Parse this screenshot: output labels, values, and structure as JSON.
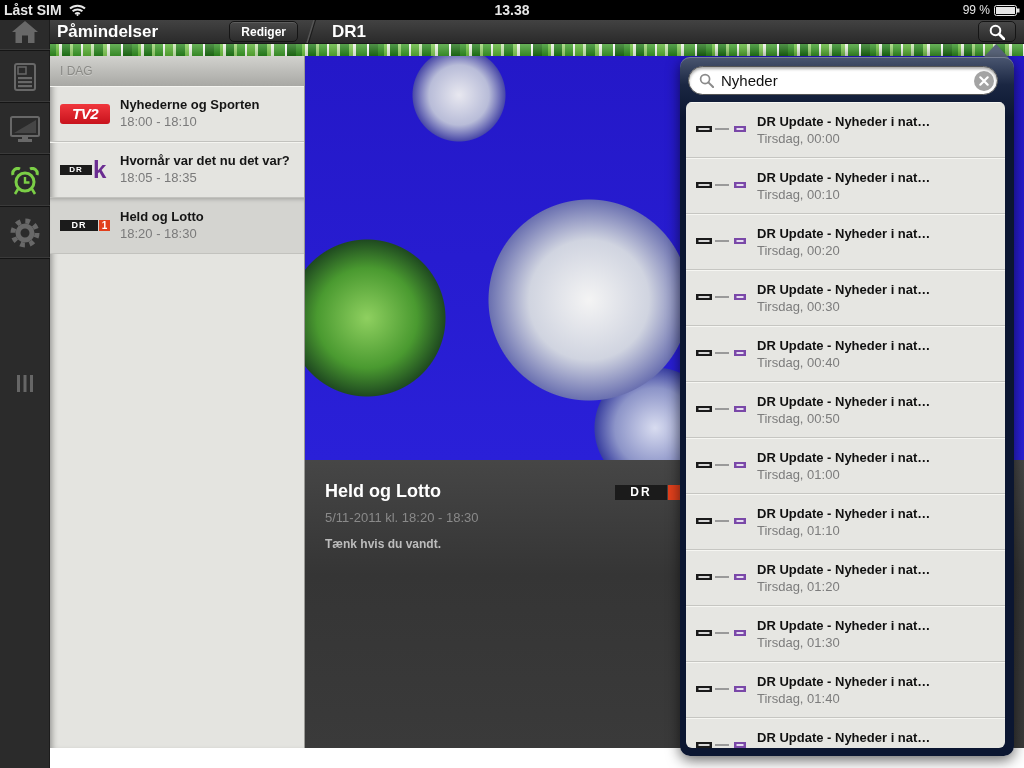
{
  "status_bar": {
    "carrier": "Låst SIM",
    "time": "13.38",
    "battery": "99 %"
  },
  "sidebar": {
    "items": [
      {
        "kind": "home",
        "selected": false
      },
      {
        "kind": "guide",
        "selected": false
      },
      {
        "kind": "tv",
        "selected": false
      },
      {
        "kind": "alarm",
        "selected": true
      },
      {
        "kind": "settings",
        "selected": false
      }
    ]
  },
  "nav_bar": {
    "title": "Påmindelser",
    "edit_button": "Rediger",
    "detail_title": "DR1"
  },
  "reminders": {
    "section": "I DAG",
    "items": [
      {
        "title": "Nyhederne og Sporten",
        "time": "18:00 - 18:10",
        "logo": {
          "kind": "tv2",
          "text": "TV2"
        },
        "selected": false
      },
      {
        "title": "Hvornår var det nu det var?",
        "time": "18:05 - 18:35",
        "logo": {
          "kind": "dr_k",
          "mark": "DR",
          "badge": "k"
        },
        "selected": false
      },
      {
        "title": "Held og Lotto",
        "time": "18:20 - 18:30",
        "logo": {
          "kind": "dr_1",
          "mark": "DR",
          "badge": "1"
        },
        "selected": true
      }
    ]
  },
  "detail": {
    "title": "Held og Lotto",
    "logo": {
      "kind": "dr_1",
      "mark": "DR"
    },
    "when": "5/11-2011 kl. 18:20 - 18:30",
    "description": "Tænk hvis du vandt."
  },
  "search": {
    "value": "Nyheder",
    "results": [
      {
        "title": "DR Update - Nyheder i nat…",
        "time": "Tirsdag, 00:00"
      },
      {
        "title": "DR Update - Nyheder i nat…",
        "time": "Tirsdag, 00:10"
      },
      {
        "title": "DR Update - Nyheder i nat…",
        "time": "Tirsdag, 00:20"
      },
      {
        "title": "DR Update - Nyheder i nat…",
        "time": "Tirsdag, 00:30"
      },
      {
        "title": "DR Update - Nyheder i nat…",
        "time": "Tirsdag, 00:40"
      },
      {
        "title": "DR Update - Nyheder i nat…",
        "time": "Tirsdag, 00:50"
      },
      {
        "title": "DR Update - Nyheder i nat…",
        "time": "Tirsdag, 01:00"
      },
      {
        "title": "DR Update - Nyheder i nat…",
        "time": "Tirsdag, 01:10"
      },
      {
        "title": "DR Update - Nyheder i nat…",
        "time": "Tirsdag, 01:20"
      },
      {
        "title": "DR Update - Nyheder i nat…",
        "time": "Tirsdag, 01:30"
      },
      {
        "title": "DR Update - Nyheder i nat…",
        "time": "Tirsdag, 01:40"
      },
      {
        "title": "DR Update - Nyheder i nat…"
      }
    ]
  }
}
